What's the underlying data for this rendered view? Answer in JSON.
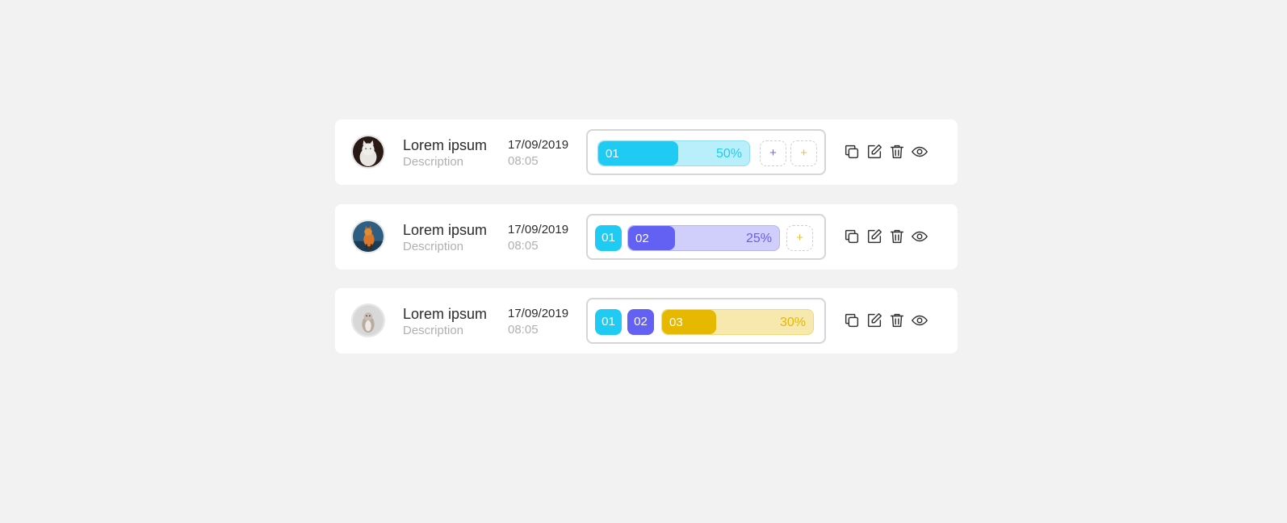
{
  "colors": {
    "cyan": "#1fcbf3",
    "cyan_light": "#b9eefb",
    "indigo": "#6360f4",
    "indigo_light": "#d0cffc",
    "yellow": "#e6b800",
    "yellow_light": "#f7e8ad",
    "plus_indigo": "#6c6af5",
    "plus_yellow": "#f0c030"
  },
  "rows": [
    {
      "avatar": "cat-avatar",
      "name": "Lorem ipsum",
      "description": "Description",
      "date": "17/09/2019",
      "time": "08:05",
      "chips": [],
      "progress": {
        "code": "01",
        "percent_label": "50%",
        "fraction": 0.53,
        "color": "cyan"
      },
      "add_buttons": [
        "+",
        "+"
      ]
    },
    {
      "avatar": "fox-avatar",
      "name": "Lorem ipsum",
      "description": "Description",
      "date": "17/09/2019",
      "time": "08:05",
      "chips": [
        "01"
      ],
      "progress": {
        "code": "02",
        "percent_label": "25%",
        "fraction": 0.31,
        "color": "indigo"
      },
      "add_buttons": [
        "+"
      ]
    },
    {
      "avatar": "squirrel-avatar",
      "name": "Lorem ipsum",
      "description": "Description",
      "date": "17/09/2019",
      "time": "08:05",
      "chips": [
        "01",
        "02"
      ],
      "progress": {
        "code": "03",
        "percent_label": "30%",
        "fraction": 0.36,
        "color": "yellow"
      },
      "add_buttons": []
    }
  ],
  "actions": [
    "copy-icon",
    "edit-icon",
    "trash-icon",
    "eye-icon"
  ]
}
